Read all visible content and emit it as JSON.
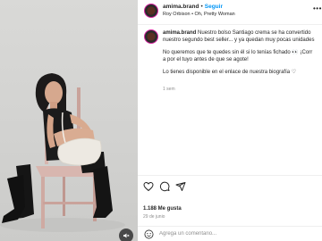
{
  "post": {
    "username": "amima.brand",
    "dot": "•",
    "follow_label": "Seguir",
    "music": "Roy Orbison • Oh, Pretty Woman",
    "more_icon": "more-horizontal-icon",
    "caption": {
      "username": "amima.brand",
      "line1": "Nuestro bolso Santiago crema se ha convertido",
      "line2": "nuestro segundo best seller... y ya quedan muy pocas unidades",
      "line3": "No queremos que te quedes sin él si lo tenías fichado 👀 ¡Corr",
      "line4": "a por el tuyo antes de que se agote!",
      "line5": "Lo tienes disponible en el enlace de nuestra biografía ♡",
      "time_ago": "1 sem"
    },
    "likes": "1.188 Me gusta",
    "date": "29 de junio",
    "comment_placeholder": "Agrega un comentario...",
    "icons": {
      "like": "heart-icon",
      "comment": "comment-icon",
      "share": "share-icon",
      "emoji": "emoji-icon",
      "mute": "speaker-muted-icon"
    }
  }
}
